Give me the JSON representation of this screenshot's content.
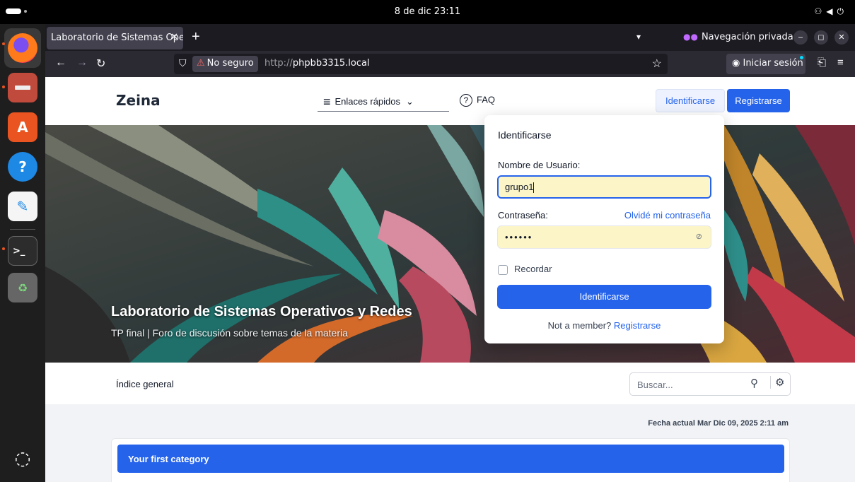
{
  "system": {
    "clock": "8 de dic  23:11"
  },
  "browser": {
    "tab_title": "Laboratorio de Sistemas Ope",
    "private_label": "Navegación privada",
    "insecure_label": "No seguro",
    "url_proto": "http://",
    "url_host": "phpbb3315.local",
    "signin_label": "Iniciar sesión"
  },
  "site": {
    "logo": "Zeina",
    "nav": {
      "quicklinks": "Enlaces rápidos",
      "faq": "FAQ",
      "login": "Identificarse",
      "register": "Registrarse"
    },
    "hero": {
      "title": "Laboratorio de Sistemas Operativos y Redes",
      "subtitle": "TP final | Foro de discusión sobre temas de la materia"
    },
    "breadcrumb": "Índice general",
    "search_placeholder": "Buscar...",
    "date": "Fecha actual Mar Dic 09, 2025 2:11 am",
    "category": "Your first category"
  },
  "login_dropdown": {
    "title": "Identificarse",
    "username_label": "Nombre de Usuario:",
    "username_value": "grupo1",
    "password_label": "Contraseña:",
    "forgot_link": "Olvidé mi contraseña",
    "password_mask": "••••••",
    "remember_label": "Recordar",
    "submit_label": "Identificarse",
    "not_member": "Not a member?",
    "register_link": "Registrarse"
  },
  "colors": {
    "accent": "#2563eb",
    "autofill": "#fcf5c7",
    "dock": "#1e1e1e",
    "browser_chrome": "#2b2a33"
  }
}
